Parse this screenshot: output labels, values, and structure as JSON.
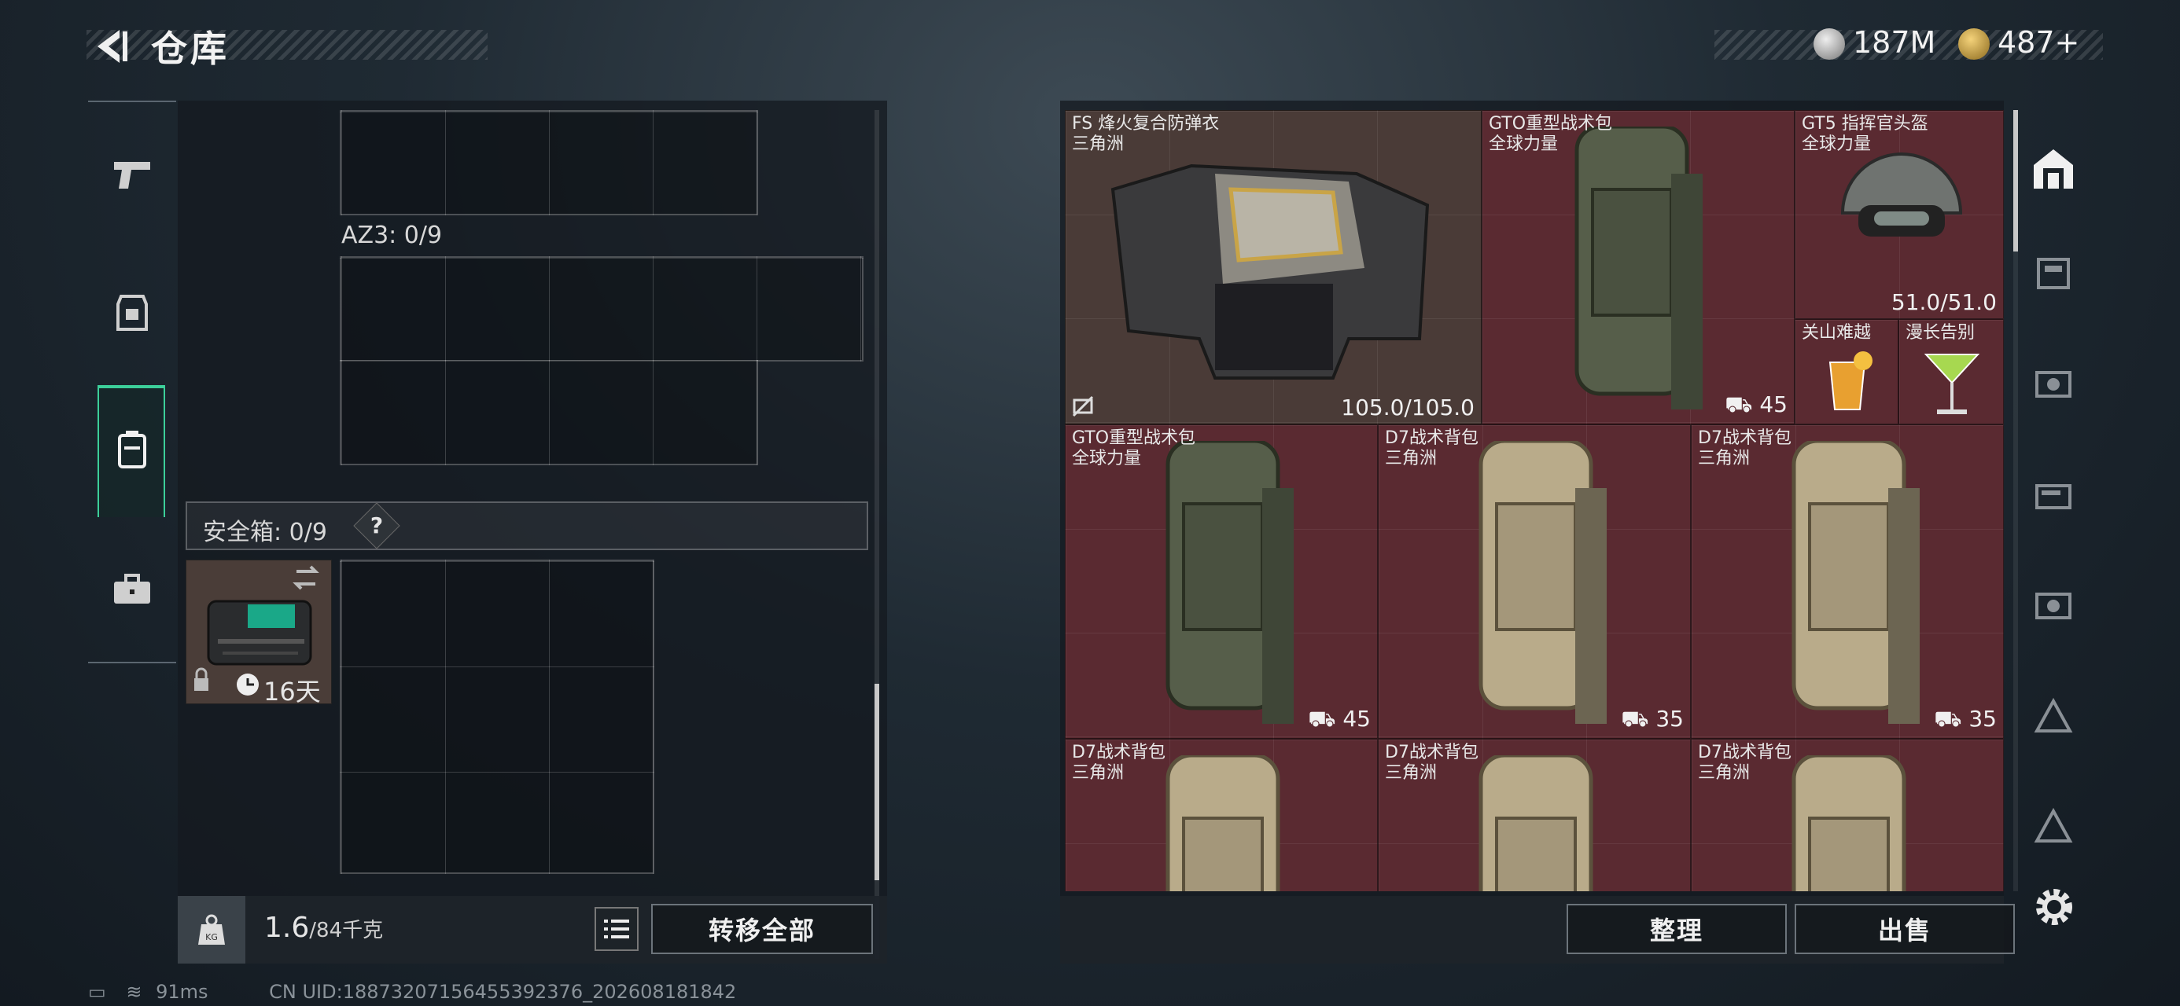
{
  "header": {
    "title": "仓库",
    "currency_1": "187M",
    "currency_2": "487+"
  },
  "left_nav": {
    "items": [
      "weapon-tab",
      "armor-tab",
      "backpack-tab",
      "case-tab"
    ],
    "active": "backpack-tab"
  },
  "containers": {
    "az3_label": "AZ3: 0/9",
    "safe_label": "安全箱: 0/9",
    "safe_help": "?",
    "safe_timer": "16天"
  },
  "bottom_left": {
    "weight_value": "1.6",
    "weight_max": "/84千克",
    "transfer_label": "转移全部"
  },
  "inventory": {
    "items": [
      {
        "name": "FS 烽火复合防弹衣",
        "sub": "三角洲",
        "value": "105.0/105.0",
        "kind": "armor",
        "bg": "brown"
      },
      {
        "name": "GTO重型战术包",
        "sub": "全球力量",
        "value": "45",
        "kind": "backpack-green",
        "bg": "red"
      },
      {
        "name": "GT5 指挥官头盔",
        "sub": "全球力量",
        "value": "51.0/51.0",
        "kind": "helmet",
        "bg": "red"
      },
      {
        "name": "关山难越",
        "sub": "",
        "value": "",
        "kind": "drink-orange",
        "bg": "red"
      },
      {
        "name": "漫长告别",
        "sub": "",
        "value": "",
        "kind": "drink-green",
        "bg": "red"
      },
      {
        "name": "GTO重型战术包",
        "sub": "全球力量",
        "value": "45",
        "kind": "backpack-green",
        "bg": "red"
      },
      {
        "name": "D7战术背包",
        "sub": "三角洲",
        "value": "35",
        "kind": "backpack-tan",
        "bg": "red"
      },
      {
        "name": "D7战术背包",
        "sub": "三角洲",
        "value": "35",
        "kind": "backpack-tan",
        "bg": "red"
      },
      {
        "name": "D7战术背包",
        "sub": "三角洲",
        "value": "",
        "kind": "backpack-tan",
        "bg": "red"
      },
      {
        "name": "D7战术背包",
        "sub": "三角洲",
        "value": "",
        "kind": "backpack-tan",
        "bg": "red"
      },
      {
        "name": "D7战术背包",
        "sub": "三角洲",
        "value": "",
        "kind": "backpack-tan",
        "bg": "red"
      }
    ]
  },
  "bottom_right": {
    "sort_label": "整理",
    "sell_label": "出售"
  },
  "status_bar": {
    "ping": "91ms",
    "uid": "CN UID:18873207156455392376_202608181842"
  },
  "colors": {
    "accent": "#3ccf9a",
    "cell_red": "#5a2a31",
    "cell_brown": "#4a3b37"
  }
}
